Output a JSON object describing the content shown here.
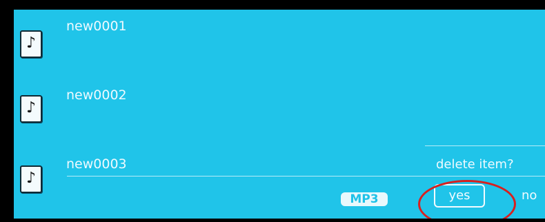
{
  "file_list": {
    "items": [
      {
        "name": "new0001",
        "icon": "music-file-icon"
      },
      {
        "name": "new0002",
        "icon": "music-file-icon"
      },
      {
        "name": "new0003",
        "icon": "music-file-icon"
      }
    ]
  },
  "dialog": {
    "prompt": "delete item?",
    "yes_label": "yes",
    "no_label": "no"
  },
  "status": {
    "format": "MP3"
  },
  "annotation": {
    "highlight_color": "#d8201f",
    "highlighted": "yes-button"
  },
  "colors": {
    "screen_background": "#20c4e9",
    "text": "#eefaff"
  }
}
